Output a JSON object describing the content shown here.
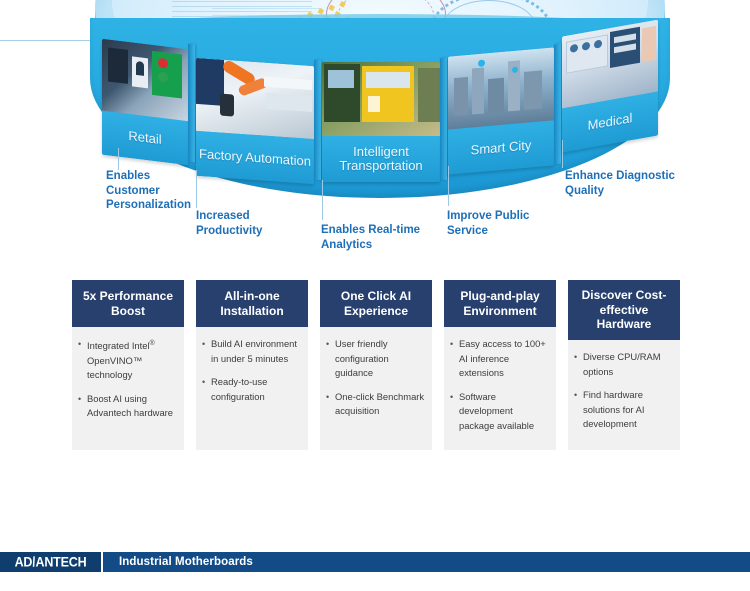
{
  "hero": {
    "segments": [
      {
        "id": "retail",
        "caption": "Retail",
        "photo": "retail-store-digital-signage"
      },
      {
        "id": "factory",
        "caption": "Factory\nAutomation",
        "photo": "robotic-arm-assembly-line"
      },
      {
        "id": "transport",
        "caption": "Intelligent\nTransportation",
        "photo": "city-bus-fleet"
      },
      {
        "id": "smartcity",
        "caption": "Smart City",
        "photo": "urban-skyline-connected"
      },
      {
        "id": "medical",
        "caption": "Medical",
        "photo": "hospital-monitoring-equipment"
      }
    ],
    "blurbs": [
      {
        "id": "retail-blurb",
        "text": "Enables\nCustomer\nPersonalization"
      },
      {
        "id": "factory-blurb",
        "text": "Increased\nProductivity"
      },
      {
        "id": "transport-blurb",
        "text": "Enables Real-time\nAnalytics"
      },
      {
        "id": "smartcity-blurb",
        "text": "Improve Public\nService"
      },
      {
        "id": "medical-blurb",
        "text": "Enhance Diagnostic\nQuality"
      }
    ]
  },
  "cards": [
    {
      "title": "5x Performance Boost",
      "bullets": [
        {
          "pre": "Integrated Intel",
          "sup": "®",
          "post": " OpenVINO™ technology"
        },
        {
          "pre": "Boost AI using Advantech hardware",
          "sup": "",
          "post": ""
        }
      ]
    },
    {
      "title": "All-in-one Installation",
      "bullets": [
        {
          "pre": "Build AI environment in under 5 minutes",
          "sup": "",
          "post": ""
        },
        {
          "pre": "Ready-to-use configuration",
          "sup": "",
          "post": ""
        }
      ]
    },
    {
      "title": "One Click AI Experience",
      "bullets": [
        {
          "pre": "User friendly configuration guidance",
          "sup": "",
          "post": ""
        },
        {
          "pre": "One-click Benchmark acquisition",
          "sup": "",
          "post": ""
        }
      ]
    },
    {
      "title": "Plug-and-play Environment",
      "bullets": [
        {
          "pre": "Easy access to 100+ AI inference extensions",
          "sup": "",
          "post": ""
        },
        {
          "pre": "Software development package available",
          "sup": "",
          "post": ""
        }
      ]
    },
    {
      "title": "Discover Cost-effective Hardware",
      "bullets": [
        {
          "pre": "Diverse CPU/RAM options",
          "sup": "",
          "post": ""
        },
        {
          "pre": "Find hardware solutions for AI development",
          "sup": "",
          "post": ""
        }
      ]
    }
  ],
  "footer": {
    "logo_a": "AD",
    "logo_slash": "\\",
    "logo_b": "ANTECH",
    "title": "Industrial Motherboards"
  },
  "colors": {
    "card_header": "#27406E",
    "card_body": "#f1f1f1",
    "blurb_blue": "#1d6fb8",
    "band_blue": "#22a5de",
    "footer_bar": "#134B86",
    "footer_logo_box": "#0F3D6E"
  }
}
